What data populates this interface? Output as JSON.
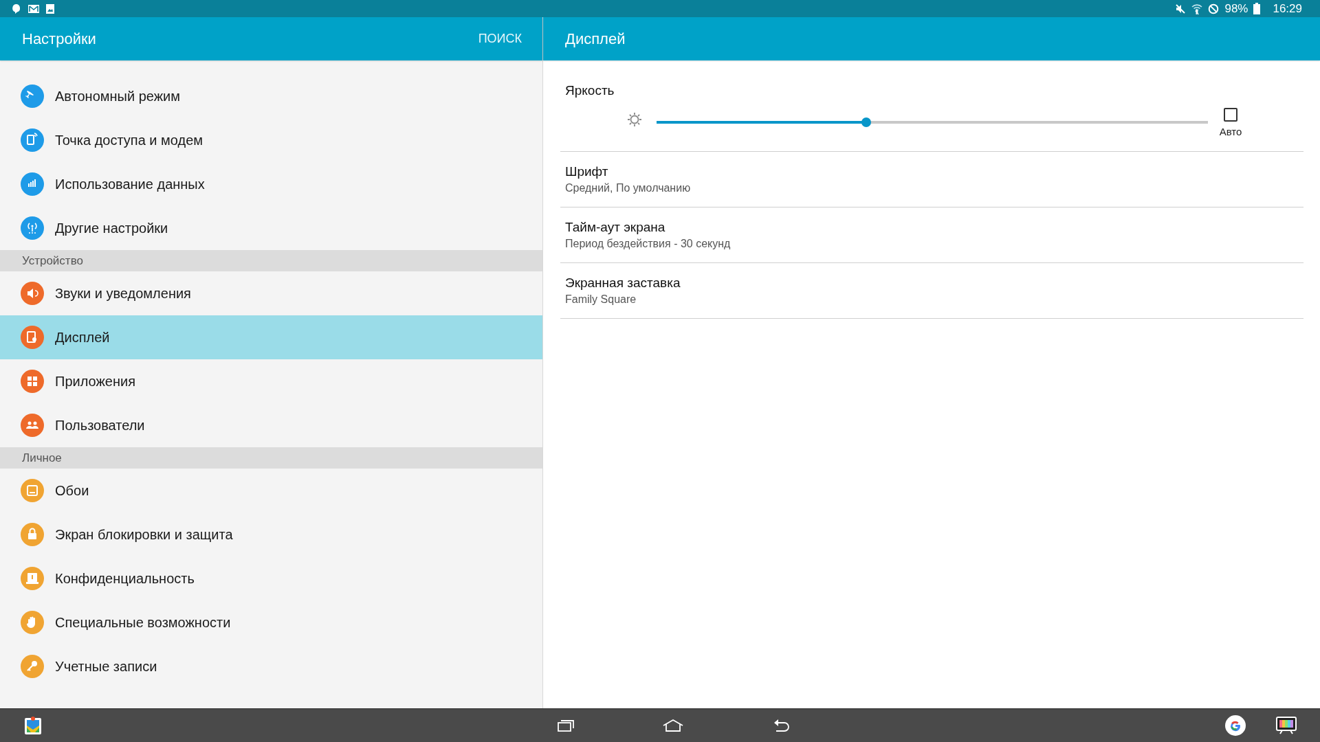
{
  "status_bar": {
    "battery": "98%",
    "time": "16:29"
  },
  "sidebar": {
    "title": "Настройки",
    "search": "ПОИСК",
    "groups": [
      {
        "items": [
          {
            "label": "Автономный режим",
            "color": "#1e9be8",
            "selected": false
          },
          {
            "label": "Точка доступа и модем",
            "color": "#1e9be8",
            "selected": false
          },
          {
            "label": "Использование данных",
            "color": "#1e9be8",
            "selected": false
          },
          {
            "label": "Другие настройки",
            "color": "#1e9be8",
            "selected": false
          }
        ]
      },
      {
        "heading": "Устройство",
        "items": [
          {
            "label": "Звуки и уведомления",
            "color": "#ee6a2a",
            "selected": false
          },
          {
            "label": "Дисплей",
            "color": "#ee6a2a",
            "selected": true
          },
          {
            "label": "Приложения",
            "color": "#ee6a2a",
            "selected": false
          },
          {
            "label": "Пользователи",
            "color": "#ee6a2a",
            "selected": false
          }
        ]
      },
      {
        "heading": "Личное",
        "items": [
          {
            "label": "Обои",
            "color": "#f0a432",
            "selected": false
          },
          {
            "label": "Экран блокировки и защита",
            "color": "#f0a432",
            "selected": false
          },
          {
            "label": "Конфиденциальность",
            "color": "#f0a432",
            "selected": false
          },
          {
            "label": "Специальные возможности",
            "color": "#f0a432",
            "selected": false
          },
          {
            "label": "Учетные записи",
            "color": "#f0a432",
            "selected": false
          }
        ]
      }
    ]
  },
  "detail": {
    "title": "Дисплей",
    "brightness": {
      "label": "Яркость",
      "level": 0.38,
      "auto": {
        "label": "Авто",
        "checked": false
      }
    },
    "items": [
      {
        "title": "Шрифт",
        "summary": "Средний, По умолчанию"
      },
      {
        "title": "Тайм-аут экрана",
        "summary": "Период бездействия - 30 секунд"
      },
      {
        "title": "Экранная заставка",
        "summary": "Family Square"
      }
    ]
  }
}
